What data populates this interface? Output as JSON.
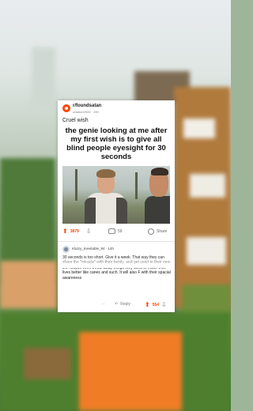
{
  "post": {
    "subreddit": "r/foundsatan",
    "byline": "u/aaron2933 · 19h",
    "title": "Cruel wish",
    "meme_caption": "the genie looking at me after my first wish is to give all blind people eyesight for 30 seconds",
    "upvotes": "3879",
    "comments": "59",
    "share_label": "Share"
  },
  "comment": {
    "username": "Klutzy_Inevitable_94 · 14h",
    "body": "30 seconds is too short.  Give it a week.  That way they can share the \"miracle\" with their family, and get used to their new life.  Maybe even throw away things they used to make their lives better like canes and such.   It will also F with their spacial awareness",
    "more_icon": "ellipsis-icon",
    "reply_label": "Reply",
    "upvotes": "554"
  },
  "colors": {
    "accent": "#ff4500"
  }
}
